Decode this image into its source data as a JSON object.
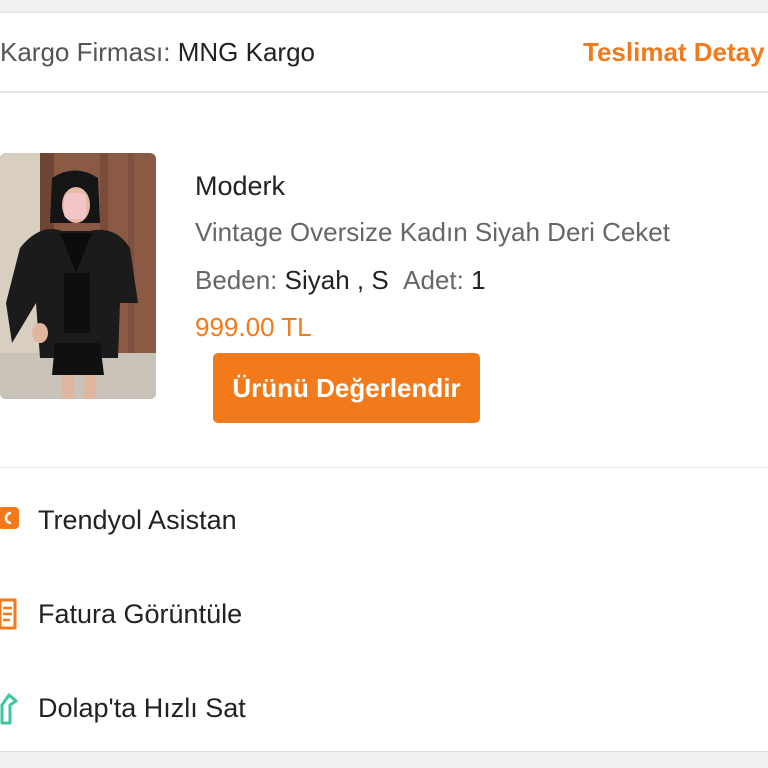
{
  "cargo": {
    "label": "Kargo Firması:",
    "company": "MNG Kargo",
    "delivery_link": "Teslimat Detay"
  },
  "product": {
    "store": "Moderk",
    "title": "Vintage Oversize Kadın Siyah Deri Ceket",
    "size_label": "Beden:",
    "size_value": "Siyah , S",
    "qty_label": "Adet:",
    "qty_value": "1",
    "price": "999.00 TL",
    "review_button": "Ürünü Değerlendir"
  },
  "menu": [
    {
      "label": "Trendyol Asistan",
      "icon": "assistant-icon"
    },
    {
      "label": "Fatura Görüntüle",
      "icon": "invoice-icon"
    },
    {
      "label": "Dolap'ta Hızlı Sat",
      "icon": "hanger-tag-icon"
    }
  ],
  "colors": {
    "accent": "#f27a1a",
    "dolap_green": "#3cc6a0"
  }
}
